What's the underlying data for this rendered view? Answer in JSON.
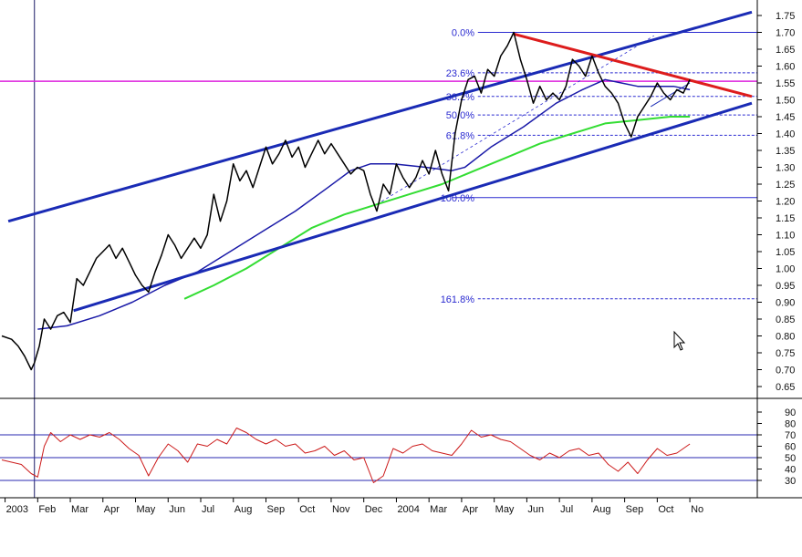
{
  "chart_data": {
    "type": "line",
    "background": "#ffffff",
    "panels": [
      {
        "name": "price",
        "y_axis": {
          "side": "right",
          "ylim": [
            0.6,
            1.8
          ],
          "ticks": [
            "0.65",
            "0.70",
            "0.75",
            "0.80",
            "0.85",
            "0.90",
            "0.95",
            "1.00",
            "1.05",
            "1.10",
            "1.15",
            "1.20",
            "1.25",
            "1.30",
            "1.35",
            "1.40",
            "1.45",
            "1.50",
            "1.55",
            "1.60",
            "1.65",
            "1.70",
            "1.75"
          ]
        },
        "grid": false
      },
      {
        "name": "oscillator",
        "y_axis": {
          "side": "right",
          "ylim": [
            20,
            95
          ],
          "ticks": [
            "30",
            "40",
            "50",
            "60",
            "70",
            "80",
            "90"
          ]
        },
        "reference_lines": [
          30,
          50,
          70
        ],
        "grid": false
      }
    ],
    "x_axis": {
      "tick_labels": [
        "2003",
        "Feb",
        "Mar",
        "Apr",
        "May",
        "Jun",
        "Jul",
        "Aug",
        "Sep",
        "Oct",
        "Nov",
        "Dec",
        "2004",
        "Mar",
        "Apr",
        "May",
        "Jun",
        "Jul",
        "Aug",
        "Sep",
        "Oct",
        "No"
      ],
      "range_months": [
        0,
        23
      ]
    },
    "colors": {
      "price": "#000000",
      "ma_short": "#1a1aa8",
      "ma_long": "#33dd33",
      "trend_channel": "#1a2bb5",
      "red_trendline": "#dd1c1c",
      "horizontal_line": "#dd22dd",
      "fib_line": "#2a2ad0",
      "oscillator": "#cc1a1a",
      "cursor_line": "#1a1a66"
    },
    "fibonacci": [
      {
        "label": "0.0%",
        "value": 1.7
      },
      {
        "label": "23.6%",
        "value": 1.58
      },
      {
        "label": "38.2%",
        "value": 1.51
      },
      {
        "label": "50.0%",
        "value": 1.455
      },
      {
        "label": "61.8%",
        "value": 1.395
      },
      {
        "label": "100.0%",
        "value": 1.21
      },
      {
        "label": "161.8%",
        "value": 0.91
      }
    ],
    "horizontal_line": {
      "value": 1.555
    },
    "vertical_cursor": {
      "month": 1.0
    },
    "trendlines": [
      {
        "name": "channel-upper",
        "points": [
          [
            0.2,
            1.14
          ],
          [
            23,
            1.76
          ]
        ]
      },
      {
        "name": "channel-lower",
        "points": [
          [
            2.2,
            0.875
          ],
          [
            23,
            1.49
          ]
        ]
      },
      {
        "name": "red-downtrend",
        "points": [
          [
            15.7,
            1.695
          ],
          [
            23,
            1.51
          ]
        ]
      }
    ],
    "price_series": [
      [
        0.0,
        0.8
      ],
      [
        0.3,
        0.79
      ],
      [
        0.5,
        0.77
      ],
      [
        0.7,
        0.74
      ],
      [
        0.9,
        0.7
      ],
      [
        1.0,
        0.72
      ],
      [
        1.15,
        0.77
      ],
      [
        1.3,
        0.85
      ],
      [
        1.5,
        0.82
      ],
      [
        1.7,
        0.86
      ],
      [
        1.9,
        0.87
      ],
      [
        2.1,
        0.84
      ],
      [
        2.3,
        0.97
      ],
      [
        2.5,
        0.95
      ],
      [
        2.7,
        0.99
      ],
      [
        2.9,
        1.03
      ],
      [
        3.1,
        1.05
      ],
      [
        3.3,
        1.07
      ],
      [
        3.5,
        1.03
      ],
      [
        3.7,
        1.06
      ],
      [
        3.9,
        1.02
      ],
      [
        4.1,
        0.98
      ],
      [
        4.3,
        0.95
      ],
      [
        4.5,
        0.93
      ],
      [
        4.7,
        0.99
      ],
      [
        4.9,
        1.04
      ],
      [
        5.1,
        1.1
      ],
      [
        5.3,
        1.07
      ],
      [
        5.5,
        1.03
      ],
      [
        5.7,
        1.06
      ],
      [
        5.9,
        1.09
      ],
      [
        6.1,
        1.06
      ],
      [
        6.3,
        1.1
      ],
      [
        6.5,
        1.22
      ],
      [
        6.7,
        1.14
      ],
      [
        6.9,
        1.2
      ],
      [
        7.1,
        1.31
      ],
      [
        7.3,
        1.26
      ],
      [
        7.5,
        1.29
      ],
      [
        7.7,
        1.24
      ],
      [
        7.9,
        1.3
      ],
      [
        8.1,
        1.36
      ],
      [
        8.3,
        1.31
      ],
      [
        8.5,
        1.34
      ],
      [
        8.7,
        1.38
      ],
      [
        8.9,
        1.33
      ],
      [
        9.1,
        1.36
      ],
      [
        9.3,
        1.3
      ],
      [
        9.5,
        1.34
      ],
      [
        9.7,
        1.38
      ],
      [
        9.9,
        1.34
      ],
      [
        10.1,
        1.37
      ],
      [
        10.3,
        1.34
      ],
      [
        10.5,
        1.31
      ],
      [
        10.7,
        1.28
      ],
      [
        10.9,
        1.3
      ],
      [
        11.1,
        1.29
      ],
      [
        11.3,
        1.22
      ],
      [
        11.5,
        1.17
      ],
      [
        11.7,
        1.25
      ],
      [
        11.9,
        1.22
      ],
      [
        12.1,
        1.31
      ],
      [
        12.3,
        1.27
      ],
      [
        12.5,
        1.24
      ],
      [
        12.7,
        1.27
      ],
      [
        12.9,
        1.32
      ],
      [
        13.1,
        1.28
      ],
      [
        13.3,
        1.35
      ],
      [
        13.5,
        1.28
      ],
      [
        13.7,
        1.23
      ],
      [
        13.9,
        1.4
      ],
      [
        14.1,
        1.5
      ],
      [
        14.3,
        1.56
      ],
      [
        14.5,
        1.57
      ],
      [
        14.7,
        1.52
      ],
      [
        14.9,
        1.59
      ],
      [
        15.1,
        1.57
      ],
      [
        15.3,
        1.63
      ],
      [
        15.5,
        1.66
      ],
      [
        15.7,
        1.7
      ],
      [
        15.9,
        1.62
      ],
      [
        16.1,
        1.56
      ],
      [
        16.3,
        1.49
      ],
      [
        16.5,
        1.54
      ],
      [
        16.7,
        1.5
      ],
      [
        16.9,
        1.52
      ],
      [
        17.1,
        1.5
      ],
      [
        17.3,
        1.54
      ],
      [
        17.5,
        1.62
      ],
      [
        17.7,
        1.6
      ],
      [
        17.9,
        1.57
      ],
      [
        18.1,
        1.63
      ],
      [
        18.3,
        1.58
      ],
      [
        18.5,
        1.54
      ],
      [
        18.7,
        1.52
      ],
      [
        18.9,
        1.49
      ],
      [
        19.1,
        1.43
      ],
      [
        19.3,
        1.39
      ],
      [
        19.5,
        1.45
      ],
      [
        19.7,
        1.48
      ],
      [
        19.9,
        1.51
      ],
      [
        20.1,
        1.55
      ],
      [
        20.3,
        1.52
      ],
      [
        20.5,
        1.5
      ],
      [
        20.7,
        1.53
      ],
      [
        20.9,
        1.52
      ],
      [
        21.1,
        1.56
      ]
    ],
    "ma_short_series": [
      [
        1.1,
        0.82
      ],
      [
        2.0,
        0.83
      ],
      [
        3.0,
        0.86
      ],
      [
        4.0,
        0.9
      ],
      [
        5.0,
        0.95
      ],
      [
        6.0,
        0.99
      ],
      [
        7.0,
        1.05
      ],
      [
        8.0,
        1.11
      ],
      [
        9.0,
        1.17
      ],
      [
        10.0,
        1.24
      ],
      [
        10.7,
        1.29
      ],
      [
        11.3,
        1.31
      ],
      [
        12.0,
        1.31
      ],
      [
        13.0,
        1.3
      ],
      [
        13.8,
        1.29
      ],
      [
        14.2,
        1.3
      ],
      [
        15.0,
        1.36
      ],
      [
        16.0,
        1.42
      ],
      [
        17.0,
        1.49
      ],
      [
        17.8,
        1.53
      ],
      [
        18.5,
        1.56
      ],
      [
        19.0,
        1.55
      ],
      [
        19.5,
        1.54
      ],
      [
        20.0,
        1.54
      ],
      [
        20.6,
        1.54
      ],
      [
        21.1,
        1.53
      ]
    ],
    "ma_long_series": [
      [
        5.6,
        0.91
      ],
      [
        6.5,
        0.95
      ],
      [
        7.5,
        1.0
      ],
      [
        8.5,
        1.06
      ],
      [
        9.5,
        1.12
      ],
      [
        10.5,
        1.16
      ],
      [
        11.5,
        1.19
      ],
      [
        12.5,
        1.22
      ],
      [
        13.5,
        1.25
      ],
      [
        14.5,
        1.29
      ],
      [
        15.5,
        1.33
      ],
      [
        16.5,
        1.37
      ],
      [
        17.5,
        1.4
      ],
      [
        18.5,
        1.43
      ],
      [
        19.5,
        1.44
      ],
      [
        20.5,
        1.45
      ],
      [
        21.1,
        1.45
      ]
    ],
    "oscillator_series": [
      [
        0.0,
        48
      ],
      [
        0.3,
        46
      ],
      [
        0.6,
        44
      ],
      [
        0.9,
        36
      ],
      [
        1.1,
        33
      ],
      [
        1.3,
        60
      ],
      [
        1.5,
        72
      ],
      [
        1.8,
        64
      ],
      [
        2.1,
        70
      ],
      [
        2.4,
        66
      ],
      [
        2.7,
        70
      ],
      [
        3.0,
        68
      ],
      [
        3.3,
        72
      ],
      [
        3.6,
        66
      ],
      [
        3.9,
        58
      ],
      [
        4.2,
        52
      ],
      [
        4.5,
        34
      ],
      [
        4.8,
        50
      ],
      [
        5.1,
        62
      ],
      [
        5.4,
        56
      ],
      [
        5.7,
        46
      ],
      [
        6.0,
        62
      ],
      [
        6.3,
        60
      ],
      [
        6.6,
        66
      ],
      [
        6.9,
        62
      ],
      [
        7.2,
        76
      ],
      [
        7.5,
        72
      ],
      [
        7.8,
        66
      ],
      [
        8.1,
        62
      ],
      [
        8.4,
        66
      ],
      [
        8.7,
        60
      ],
      [
        9.0,
        62
      ],
      [
        9.3,
        54
      ],
      [
        9.6,
        56
      ],
      [
        9.9,
        60
      ],
      [
        10.2,
        52
      ],
      [
        10.5,
        56
      ],
      [
        10.8,
        48
      ],
      [
        11.1,
        50
      ],
      [
        11.4,
        28
      ],
      [
        11.7,
        34
      ],
      [
        12.0,
        58
      ],
      [
        12.3,
        54
      ],
      [
        12.6,
        60
      ],
      [
        12.9,
        62
      ],
      [
        13.2,
        56
      ],
      [
        13.5,
        54
      ],
      [
        13.8,
        52
      ],
      [
        14.1,
        62
      ],
      [
        14.4,
        74
      ],
      [
        14.7,
        68
      ],
      [
        15.0,
        70
      ],
      [
        15.3,
        66
      ],
      [
        15.6,
        64
      ],
      [
        15.9,
        58
      ],
      [
        16.2,
        52
      ],
      [
        16.5,
        48
      ],
      [
        16.8,
        54
      ],
      [
        17.1,
        50
      ],
      [
        17.4,
        56
      ],
      [
        17.7,
        58
      ],
      [
        18.0,
        52
      ],
      [
        18.3,
        54
      ],
      [
        18.6,
        44
      ],
      [
        18.9,
        38
      ],
      [
        19.2,
        46
      ],
      [
        19.5,
        36
      ],
      [
        19.8,
        48
      ],
      [
        20.1,
        58
      ],
      [
        20.4,
        52
      ],
      [
        20.7,
        54
      ],
      [
        21.1,
        62
      ]
    ],
    "trendline_small": [
      [
        19.9,
        1.48
      ],
      [
        21.1,
        1.55
      ]
    ],
    "dashed_helper": [
      [
        11.5,
        1.19
      ],
      [
        20.0,
        1.69
      ]
    ]
  }
}
